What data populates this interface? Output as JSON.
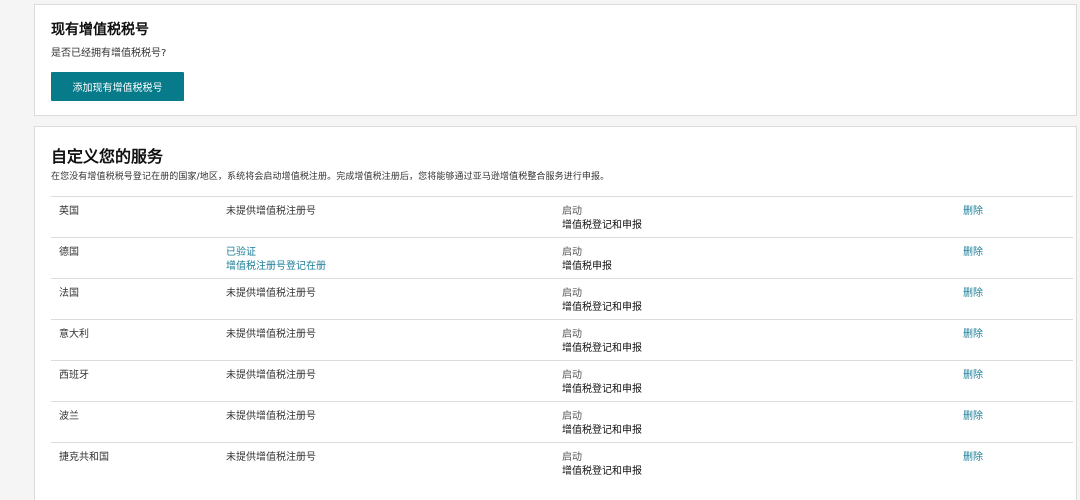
{
  "existing_vat": {
    "title": "现有增值税税号",
    "subtitle": "是否已经拥有增值税税号?",
    "add_button": "添加现有增值税税号"
  },
  "customize": {
    "title": "自定义您的服务",
    "description": "在您没有增值税税号登记在册的国家/地区，系统将会启动增值税注册。完成增值税注册后，您将能够通过亚马逊增值税整合服务进行申报。",
    "rows": [
      {
        "country": "英国",
        "reg_line1": "未提供增值税注册号",
        "reg_line2": "",
        "status": "启动",
        "service": "增值税登记和申报",
        "action": "删除"
      },
      {
        "country": "德国",
        "reg_line1": "已验证",
        "reg_line2": "增值税注册号登记在册",
        "status": "启动",
        "service": "增值税申报",
        "action": "删除"
      },
      {
        "country": "法国",
        "reg_line1": "未提供增值税注册号",
        "reg_line2": "",
        "status": "启动",
        "service": "增值税登记和申报",
        "action": "删除"
      },
      {
        "country": "意大利",
        "reg_line1": "未提供增值税注册号",
        "reg_line2": "",
        "status": "启动",
        "service": "增值税登记和申报",
        "action": "删除"
      },
      {
        "country": "西班牙",
        "reg_line1": "未提供增值税注册号",
        "reg_line2": "",
        "status": "启动",
        "service": "增值税登记和申报",
        "action": "删除"
      },
      {
        "country": "波兰",
        "reg_line1": "未提供增值税注册号",
        "reg_line2": "",
        "status": "启动",
        "service": "增值税登记和申报",
        "action": "删除"
      },
      {
        "country": "捷克共和国",
        "reg_line1": "未提供增值税注册号",
        "reg_line2": "",
        "status": "启动",
        "service": "增值税登记和申报",
        "action": "删除"
      }
    ]
  },
  "colors": {
    "button": "#087b8a",
    "link": "#1a7d98"
  }
}
